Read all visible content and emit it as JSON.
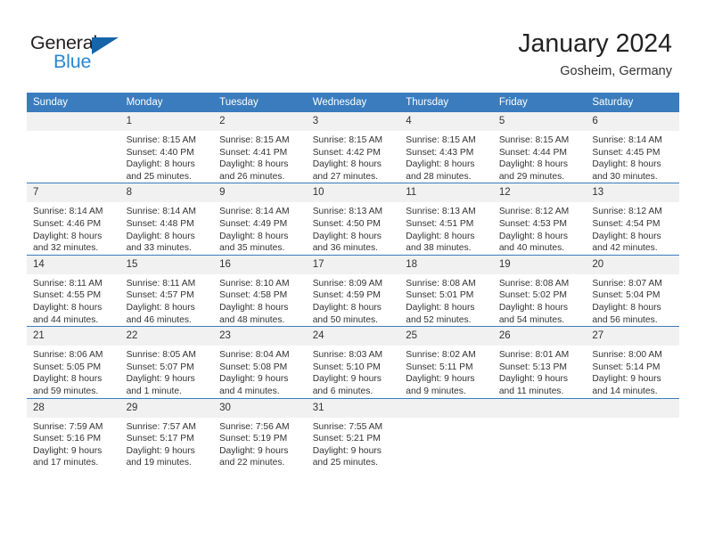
{
  "brand": {
    "name_part1": "General",
    "name_part2": "Blue",
    "accent_color": "#2a87d0",
    "triangle_color": "#1565a8"
  },
  "header": {
    "month_title": "January 2024",
    "location": "Gosheim, Germany"
  },
  "theme": {
    "header_blue": "#3a7cbd",
    "daynum_band": "#f1f1f1",
    "text": "#333333"
  },
  "weekday_headers": [
    "Sunday",
    "Monday",
    "Tuesday",
    "Wednesday",
    "Thursday",
    "Friday",
    "Saturday"
  ],
  "weeks": [
    [
      {
        "day": "",
        "sunrise": "",
        "sunset": "",
        "daylight_line1": "",
        "daylight_line2": "",
        "blank": true
      },
      {
        "day": "1",
        "sunrise": "Sunrise: 8:15 AM",
        "sunset": "Sunset: 4:40 PM",
        "daylight_line1": "Daylight: 8 hours",
        "daylight_line2": "and 25 minutes."
      },
      {
        "day": "2",
        "sunrise": "Sunrise: 8:15 AM",
        "sunset": "Sunset: 4:41 PM",
        "daylight_line1": "Daylight: 8 hours",
        "daylight_line2": "and 26 minutes."
      },
      {
        "day": "3",
        "sunrise": "Sunrise: 8:15 AM",
        "sunset": "Sunset: 4:42 PM",
        "daylight_line1": "Daylight: 8 hours",
        "daylight_line2": "and 27 minutes."
      },
      {
        "day": "4",
        "sunrise": "Sunrise: 8:15 AM",
        "sunset": "Sunset: 4:43 PM",
        "daylight_line1": "Daylight: 8 hours",
        "daylight_line2": "and 28 minutes."
      },
      {
        "day": "5",
        "sunrise": "Sunrise: 8:15 AM",
        "sunset": "Sunset: 4:44 PM",
        "daylight_line1": "Daylight: 8 hours",
        "daylight_line2": "and 29 minutes."
      },
      {
        "day": "6",
        "sunrise": "Sunrise: 8:14 AM",
        "sunset": "Sunset: 4:45 PM",
        "daylight_line1": "Daylight: 8 hours",
        "daylight_line2": "and 30 minutes."
      }
    ],
    [
      {
        "day": "7",
        "sunrise": "Sunrise: 8:14 AM",
        "sunset": "Sunset: 4:46 PM",
        "daylight_line1": "Daylight: 8 hours",
        "daylight_line2": "and 32 minutes."
      },
      {
        "day": "8",
        "sunrise": "Sunrise: 8:14 AM",
        "sunset": "Sunset: 4:48 PM",
        "daylight_line1": "Daylight: 8 hours",
        "daylight_line2": "and 33 minutes."
      },
      {
        "day": "9",
        "sunrise": "Sunrise: 8:14 AM",
        "sunset": "Sunset: 4:49 PM",
        "daylight_line1": "Daylight: 8 hours",
        "daylight_line2": "and 35 minutes."
      },
      {
        "day": "10",
        "sunrise": "Sunrise: 8:13 AM",
        "sunset": "Sunset: 4:50 PM",
        "daylight_line1": "Daylight: 8 hours",
        "daylight_line2": "and 36 minutes."
      },
      {
        "day": "11",
        "sunrise": "Sunrise: 8:13 AM",
        "sunset": "Sunset: 4:51 PM",
        "daylight_line1": "Daylight: 8 hours",
        "daylight_line2": "and 38 minutes."
      },
      {
        "day": "12",
        "sunrise": "Sunrise: 8:12 AM",
        "sunset": "Sunset: 4:53 PM",
        "daylight_line1": "Daylight: 8 hours",
        "daylight_line2": "and 40 minutes."
      },
      {
        "day": "13",
        "sunrise": "Sunrise: 8:12 AM",
        "sunset": "Sunset: 4:54 PM",
        "daylight_line1": "Daylight: 8 hours",
        "daylight_line2": "and 42 minutes."
      }
    ],
    [
      {
        "day": "14",
        "sunrise": "Sunrise: 8:11 AM",
        "sunset": "Sunset: 4:55 PM",
        "daylight_line1": "Daylight: 8 hours",
        "daylight_line2": "and 44 minutes."
      },
      {
        "day": "15",
        "sunrise": "Sunrise: 8:11 AM",
        "sunset": "Sunset: 4:57 PM",
        "daylight_line1": "Daylight: 8 hours",
        "daylight_line2": "and 46 minutes."
      },
      {
        "day": "16",
        "sunrise": "Sunrise: 8:10 AM",
        "sunset": "Sunset: 4:58 PM",
        "daylight_line1": "Daylight: 8 hours",
        "daylight_line2": "and 48 minutes."
      },
      {
        "day": "17",
        "sunrise": "Sunrise: 8:09 AM",
        "sunset": "Sunset: 4:59 PM",
        "daylight_line1": "Daylight: 8 hours",
        "daylight_line2": "and 50 minutes."
      },
      {
        "day": "18",
        "sunrise": "Sunrise: 8:08 AM",
        "sunset": "Sunset: 5:01 PM",
        "daylight_line1": "Daylight: 8 hours",
        "daylight_line2": "and 52 minutes."
      },
      {
        "day": "19",
        "sunrise": "Sunrise: 8:08 AM",
        "sunset": "Sunset: 5:02 PM",
        "daylight_line1": "Daylight: 8 hours",
        "daylight_line2": "and 54 minutes."
      },
      {
        "day": "20",
        "sunrise": "Sunrise: 8:07 AM",
        "sunset": "Sunset: 5:04 PM",
        "daylight_line1": "Daylight: 8 hours",
        "daylight_line2": "and 56 minutes."
      }
    ],
    [
      {
        "day": "21",
        "sunrise": "Sunrise: 8:06 AM",
        "sunset": "Sunset: 5:05 PM",
        "daylight_line1": "Daylight: 8 hours",
        "daylight_line2": "and 59 minutes."
      },
      {
        "day": "22",
        "sunrise": "Sunrise: 8:05 AM",
        "sunset": "Sunset: 5:07 PM",
        "daylight_line1": "Daylight: 9 hours",
        "daylight_line2": "and 1 minute."
      },
      {
        "day": "23",
        "sunrise": "Sunrise: 8:04 AM",
        "sunset": "Sunset: 5:08 PM",
        "daylight_line1": "Daylight: 9 hours",
        "daylight_line2": "and 4 minutes."
      },
      {
        "day": "24",
        "sunrise": "Sunrise: 8:03 AM",
        "sunset": "Sunset: 5:10 PM",
        "daylight_line1": "Daylight: 9 hours",
        "daylight_line2": "and 6 minutes."
      },
      {
        "day": "25",
        "sunrise": "Sunrise: 8:02 AM",
        "sunset": "Sunset: 5:11 PM",
        "daylight_line1": "Daylight: 9 hours",
        "daylight_line2": "and 9 minutes."
      },
      {
        "day": "26",
        "sunrise": "Sunrise: 8:01 AM",
        "sunset": "Sunset: 5:13 PM",
        "daylight_line1": "Daylight: 9 hours",
        "daylight_line2": "and 11 minutes."
      },
      {
        "day": "27",
        "sunrise": "Sunrise: 8:00 AM",
        "sunset": "Sunset: 5:14 PM",
        "daylight_line1": "Daylight: 9 hours",
        "daylight_line2": "and 14 minutes."
      }
    ],
    [
      {
        "day": "28",
        "sunrise": "Sunrise: 7:59 AM",
        "sunset": "Sunset: 5:16 PM",
        "daylight_line1": "Daylight: 9 hours",
        "daylight_line2": "and 17 minutes."
      },
      {
        "day": "29",
        "sunrise": "Sunrise: 7:57 AM",
        "sunset": "Sunset: 5:17 PM",
        "daylight_line1": "Daylight: 9 hours",
        "daylight_line2": "and 19 minutes."
      },
      {
        "day": "30",
        "sunrise": "Sunrise: 7:56 AM",
        "sunset": "Sunset: 5:19 PM",
        "daylight_line1": "Daylight: 9 hours",
        "daylight_line2": "and 22 minutes."
      },
      {
        "day": "31",
        "sunrise": "Sunrise: 7:55 AM",
        "sunset": "Sunset: 5:21 PM",
        "daylight_line1": "Daylight: 9 hours",
        "daylight_line2": "and 25 minutes."
      },
      {
        "day": "",
        "sunrise": "",
        "sunset": "",
        "daylight_line1": "",
        "daylight_line2": "",
        "blank": true
      },
      {
        "day": "",
        "sunrise": "",
        "sunset": "",
        "daylight_line1": "",
        "daylight_line2": "",
        "blank": true
      },
      {
        "day": "",
        "sunrise": "",
        "sunset": "",
        "daylight_line1": "",
        "daylight_line2": "",
        "blank": true
      }
    ]
  ]
}
